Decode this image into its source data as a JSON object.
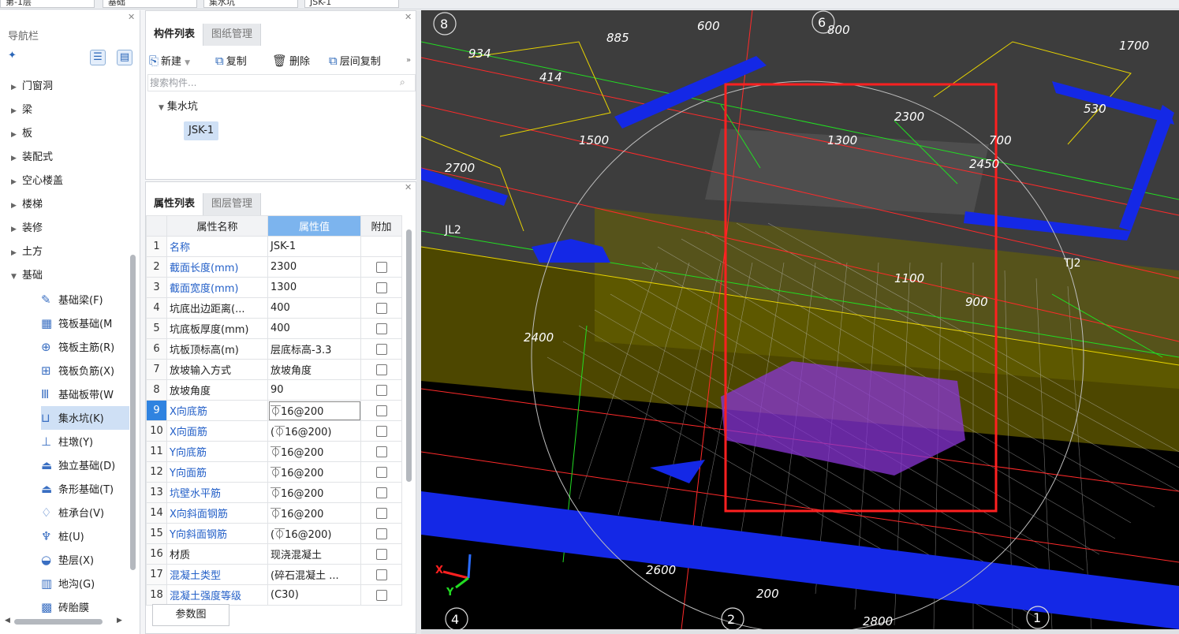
{
  "top": {
    "floor": "第-1层",
    "category": "基础",
    "type": "集水坑",
    "name": "JSK-1"
  },
  "nav": {
    "title": "导航栏",
    "groups": [
      "门窗洞",
      "梁",
      "板",
      "装配式",
      "空心楼盖",
      "楼梯",
      "装修",
      "土方"
    ],
    "open_group": "基础",
    "leaves": [
      {
        "label": "基础梁(F)",
        "icon": "pencil-icon"
      },
      {
        "label": "筏板基础(M",
        "icon": "grid-icon"
      },
      {
        "label": "筏板主筋(R)",
        "icon": "rebar-main-icon"
      },
      {
        "label": "筏板负筋(X)",
        "icon": "rebar-neg-icon"
      },
      {
        "label": "基础板带(W",
        "icon": "strip-icon"
      },
      {
        "label": "集水坑(K)",
        "icon": "pit-icon",
        "selected": true
      },
      {
        "label": "柱墩(Y)",
        "icon": "pier-icon"
      },
      {
        "label": "独立基础(D)",
        "icon": "isolated-footing-icon"
      },
      {
        "label": "条形基础(T)",
        "icon": "strip-footing-icon"
      },
      {
        "label": "桩承台(V)",
        "icon": "pile-cap-icon"
      },
      {
        "label": "桩(U)",
        "icon": "pile-icon"
      },
      {
        "label": "垫层(X)",
        "icon": "cushion-icon"
      },
      {
        "label": "地沟(G)",
        "icon": "trench-icon"
      },
      {
        "label": "砖胎膜",
        "icon": "brick-icon"
      }
    ]
  },
  "comp": {
    "tabs": [
      "构件列表",
      "图纸管理"
    ],
    "toolbar": {
      "new": "新建",
      "copy": "复制",
      "delete": "删除",
      "layer_copy": "层间复制"
    },
    "search_placeholder": "搜索构件...",
    "tree_parent": "集水坑",
    "tree_child": "JSK-1"
  },
  "props": {
    "tabs": [
      "属性列表",
      "图层管理"
    ],
    "headers": {
      "name": "属性名称",
      "value": "属性值",
      "extra": "附加"
    },
    "rows": [
      {
        "n": "1",
        "name": "名称",
        "value": "JSK-1",
        "blue": true,
        "cb": false
      },
      {
        "n": "2",
        "name": "截面长度(mm)",
        "value": "2300",
        "blue": true,
        "cb": true
      },
      {
        "n": "3",
        "name": "截面宽度(mm)",
        "value": "1300",
        "blue": true,
        "cb": true
      },
      {
        "n": "4",
        "name": "坑底出边距离(...",
        "value": "400",
        "blue": false,
        "cb": true
      },
      {
        "n": "5",
        "name": "坑底板厚度(mm)",
        "value": "400",
        "blue": false,
        "cb": true
      },
      {
        "n": "6",
        "name": "坑板顶标高(m)",
        "value": "层底标高-3.3",
        "blue": false,
        "cb": true
      },
      {
        "n": "7",
        "name": "放坡输入方式",
        "value": "放坡角度",
        "blue": false,
        "cb": true
      },
      {
        "n": "8",
        "name": "放坡角度",
        "value": "90",
        "blue": false,
        "cb": true
      },
      {
        "n": "9",
        "name": "X向底筋",
        "value": "⏁16@200",
        "blue": true,
        "cb": true,
        "sel": true
      },
      {
        "n": "10",
        "name": "X向面筋",
        "value": "(⏁16@200)",
        "blue": true,
        "cb": true
      },
      {
        "n": "11",
        "name": "Y向底筋",
        "value": "⏁16@200",
        "blue": true,
        "cb": true
      },
      {
        "n": "12",
        "name": "Y向面筋",
        "value": "⏁16@200",
        "blue": true,
        "cb": true
      },
      {
        "n": "13",
        "name": "坑壁水平筋",
        "value": "⏁16@200",
        "blue": true,
        "cb": true
      },
      {
        "n": "14",
        "name": "X向斜面钢筋",
        "value": "⏁16@200",
        "blue": true,
        "cb": true
      },
      {
        "n": "15",
        "name": "Y向斜面钢筋",
        "value": "(⏁16@200)",
        "blue": true,
        "cb": true
      },
      {
        "n": "16",
        "name": "材质",
        "value": "现浇混凝土",
        "blue": false,
        "cb": true
      },
      {
        "n": "17",
        "name": "混凝土类型",
        "value": "(碎石混凝土 ...",
        "blue": true,
        "cb": true
      },
      {
        "n": "18",
        "name": "混凝土强度等级",
        "value": "(C30)",
        "blue": true,
        "cb": true
      }
    ],
    "param_button": "参数图"
  },
  "view": {
    "dims": [
      "2600",
      "200",
      "2800",
      "2300",
      "1300",
      "1100",
      "2700",
      "800",
      "900",
      "414",
      "934",
      "885",
      "600",
      "1500",
      "2400",
      "1700",
      "530",
      "2450",
      "700"
    ],
    "axis": [
      "8",
      "6",
      "4",
      "2",
      "1"
    ],
    "labels": [
      "JL2",
      "TJ2"
    ],
    "highlight_color": "#ff2020"
  }
}
